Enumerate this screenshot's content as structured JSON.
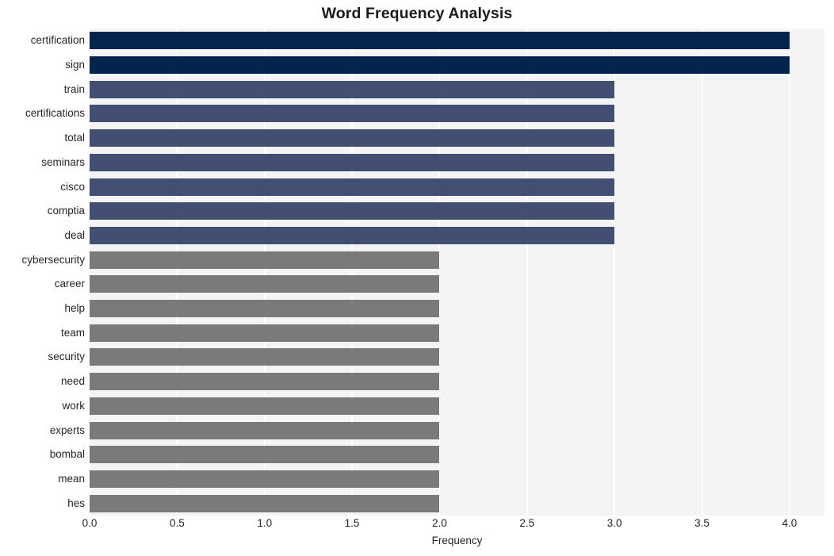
{
  "chart_data": {
    "type": "bar",
    "orientation": "horizontal",
    "title": "Word Frequency Analysis",
    "xlabel": "Frequency",
    "ylabel": "",
    "categories": [
      "certification",
      "sign",
      "train",
      "certifications",
      "total",
      "seminars",
      "cisco",
      "comptia",
      "deal",
      "cybersecurity",
      "career",
      "help",
      "team",
      "security",
      "need",
      "work",
      "experts",
      "bombal",
      "mean",
      "hes"
    ],
    "values": [
      4,
      4,
      3,
      3,
      3,
      3,
      3,
      3,
      3,
      2,
      2,
      2,
      2,
      2,
      2,
      2,
      2,
      2,
      2,
      2
    ],
    "bar_colors": [
      "#03244d",
      "#03244d",
      "#424f72",
      "#424f72",
      "#424f72",
      "#424f72",
      "#424f72",
      "#424f72",
      "#424f72",
      "#7a7a78",
      "#7a7a78",
      "#7a7a78",
      "#7a7a78",
      "#7a7a78",
      "#7a7a78",
      "#7a7a78",
      "#7a7a78",
      "#7a7a78",
      "#7a7a78",
      "#7a7a78"
    ],
    "xlim": [
      0.0,
      4.2
    ],
    "xticks": [
      0.0,
      0.5,
      1.0,
      1.5,
      2.0,
      2.5,
      3.0,
      3.5,
      4.0
    ],
    "xtick_labels": [
      "0.0",
      "0.5",
      "1.0",
      "1.5",
      "2.0",
      "2.5",
      "3.0",
      "3.5",
      "4.0"
    ],
    "grid": true,
    "grid_axis": "x",
    "grid_color": "#ffffff",
    "plot_background": "#f4f4f5",
    "figure_background": "#ffffff",
    "legend": null
  }
}
